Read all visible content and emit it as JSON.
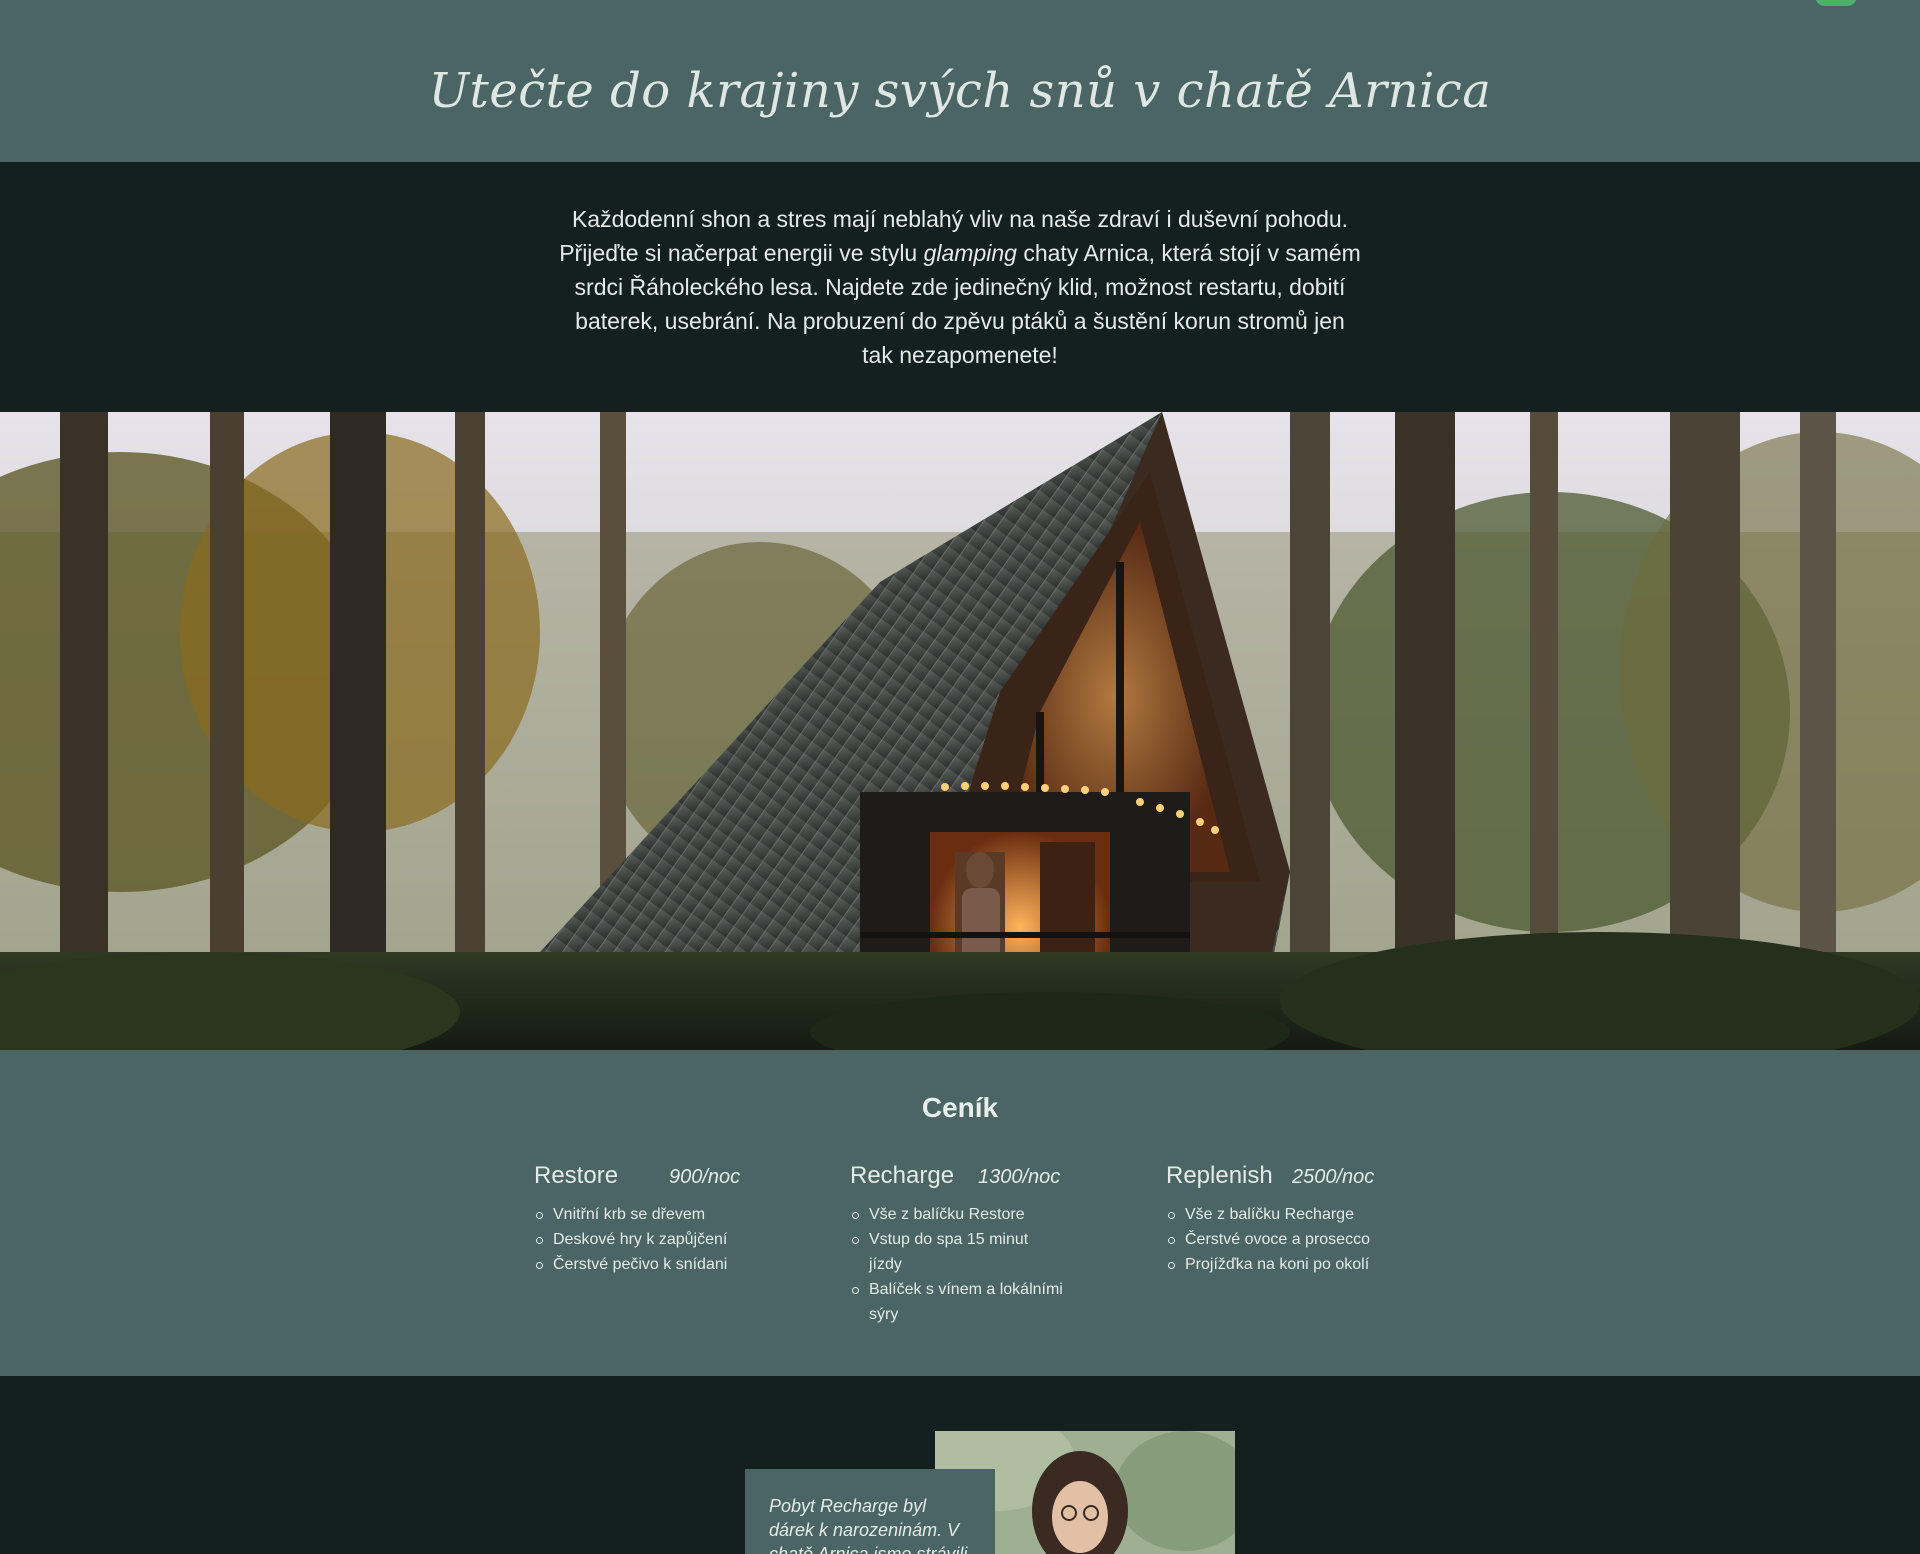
{
  "header": {
    "title": "Utečte do krajiny svých snů v chatě Arnica"
  },
  "intro": {
    "text_before": "Každodenní shon a stres mají neblahý vliv na naše zdraví i duševní pohodu. Přijeďte si načerpat energii ve stylu ",
    "text_em": "glamping",
    "text_after": " chaty Arnica, která stojí v samém srdci Řáholeckého lesa. Najdete zde jedinečný klid, možnost restartu, dobití baterek, usebrání. Na probuzení do zpěvu ptáků a šustění korun stromů jen tak nezapomenete!"
  },
  "pricing": {
    "heading": "Ceník",
    "plans": [
      {
        "name": "Restore",
        "price": "900/noc",
        "items": [
          "Vnitřní krb se dřevem",
          "Deskové hry k zapůjčení",
          "Čerstvé pečivo k snídani"
        ]
      },
      {
        "name": "Recharge",
        "price": "1300/noc",
        "items": [
          "Vše z balíčku Restore",
          "Vstup do spa 15 minut jízdy",
          "Balíček s vínem a lokálními sýry"
        ]
      },
      {
        "name": "Replenish",
        "price": "2500/noc",
        "items": [
          "Vše z balíčku Recharge",
          "Čerstvé ovoce a prosecco",
          "Projížďka na koni po okolí"
        ]
      }
    ]
  },
  "review": {
    "quote": "Pobyt Recharge byl dárek k narozeninám. V chatě Arnica jsme strávili"
  },
  "colors": {
    "header_bg": "#4a6563",
    "dark_bg": "#142020",
    "text_light": "#e3ebe9",
    "toggle_accent": "#4eb06c"
  },
  "icons": {
    "logo": "arnica-logo-script",
    "toggle": "toggle-switch"
  }
}
